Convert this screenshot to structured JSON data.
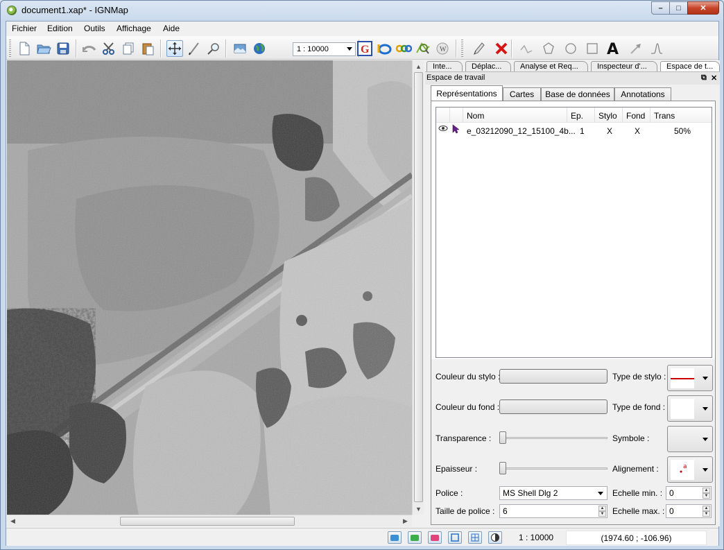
{
  "window": {
    "title": "document1.xap* - IGNMap"
  },
  "menu": [
    "Fichier",
    "Edition",
    "Outils",
    "Affichage",
    "Aide"
  ],
  "toolbar": {
    "scale_value": "1 : 10000"
  },
  "doc_tabs": [
    "Inte...",
    "Déplac...",
    "Analyse et Req...",
    "Inspecteur d'...",
    "Espace de t..."
  ],
  "panel": {
    "title": "Espace de travail",
    "tabs": [
      "Représentations",
      "Cartes",
      "Base de données",
      "Annotations"
    ],
    "columns": [
      "Nom",
      "Ep.",
      "Stylo",
      "Fond",
      "Trans"
    ],
    "layers": [
      {
        "name": "e_03212090_12_15100_4b...",
        "ep": "1",
        "stylo": "X",
        "fond": "X",
        "trans": "50%"
      }
    ]
  },
  "props": {
    "couleur_stylo": "Couleur du stylo :",
    "type_stylo": "Type de stylo :",
    "couleur_fond": "Couleur du fond :",
    "type_fond": "Type de fond :",
    "transparence": "Transparence :",
    "symbole": "Symbole :",
    "epaisseur": "Epaisseur :",
    "alignement": "Alignement :",
    "police": "Police :",
    "police_value": "MS Shell Dlg 2",
    "echelle_min": "Echelle min. :",
    "echelle_min_value": "0",
    "taille_police": "Taille de police :",
    "taille_police_value": "6",
    "echelle_max": "Echelle max. :",
    "echelle_max_value": "0",
    "transparence_level": 0,
    "epaisseur_level": 0,
    "pen_color": "#cc0000"
  },
  "status": {
    "scale": "1 : 10000",
    "coords": "(1974.60 ; -106.96)"
  }
}
